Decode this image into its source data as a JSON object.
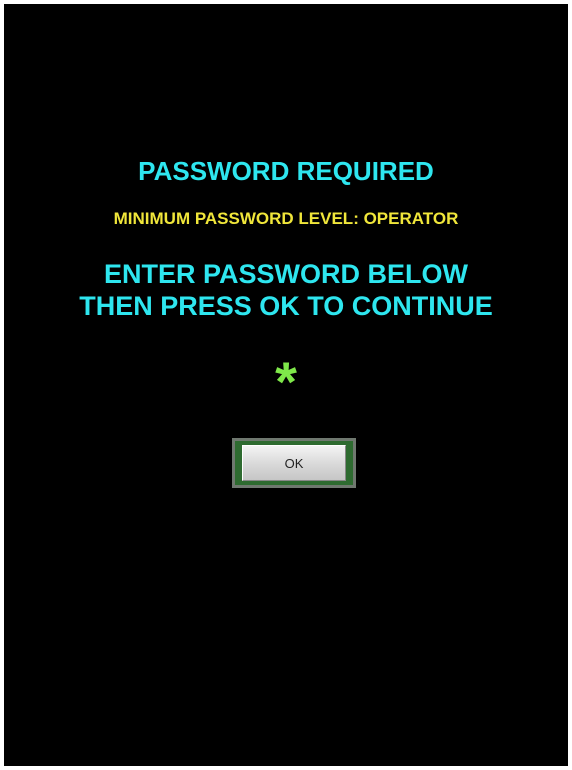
{
  "dialog": {
    "title": "PASSWORD REQUIRED",
    "min_level": "MINIMUM PASSWORD LEVEL: OPERATOR",
    "instructions_line1": "ENTER PASSWORD BELOW",
    "instructions_line2": "THEN PRESS OK TO CONTINUE",
    "password_value": "*",
    "ok_label": "OK"
  },
  "colors": {
    "background": "#000000",
    "title_text": "#2ee6ef",
    "level_text": "#f0e63a",
    "password_text": "#7fe84a",
    "button_frame": "#2e6b30"
  }
}
